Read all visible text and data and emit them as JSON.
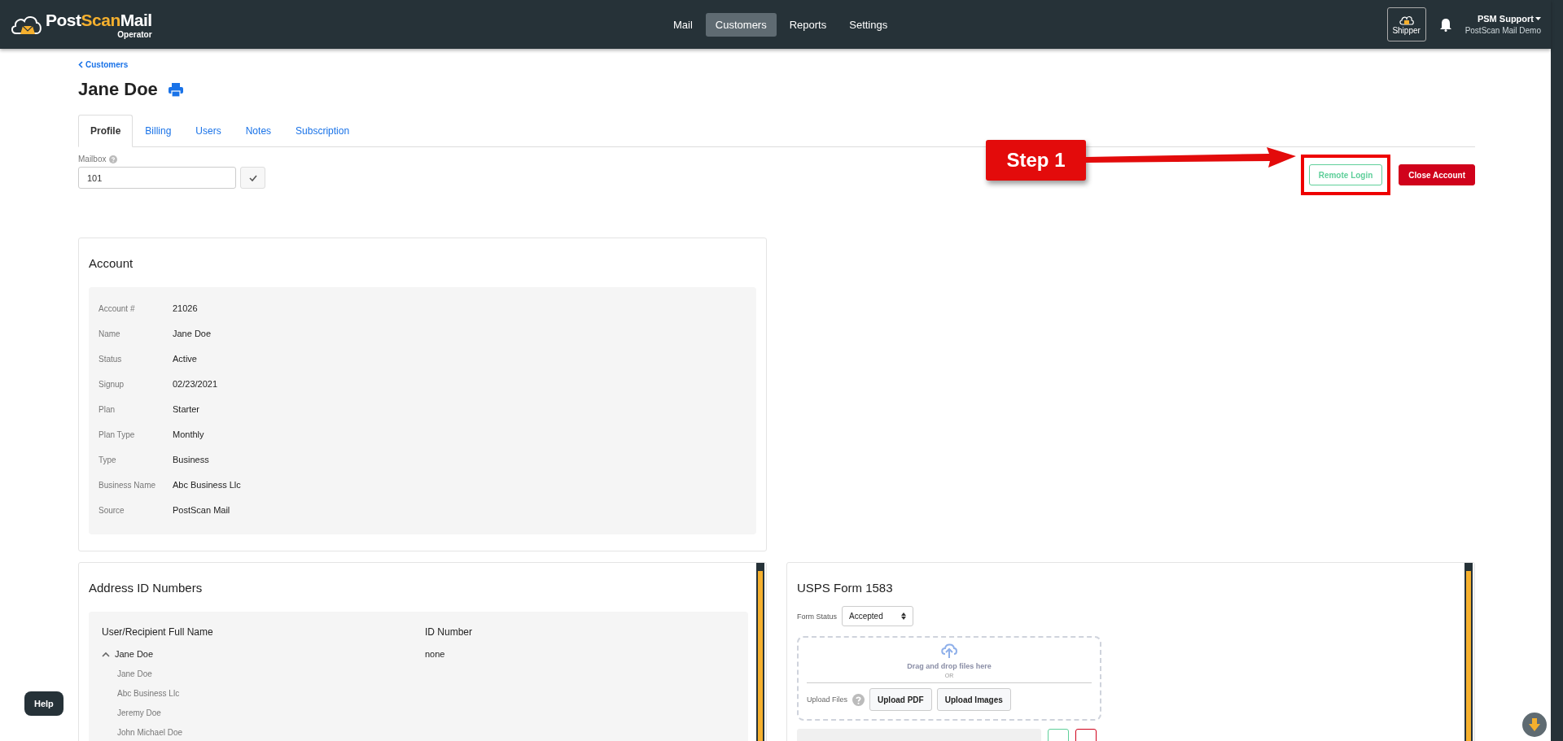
{
  "header": {
    "logo": {
      "part_1": "Post",
      "part_2": "Scan",
      "part_3": "Mail",
      "subtitle": "Operator"
    },
    "nav": [
      {
        "label": "Mail",
        "selected": false
      },
      {
        "label": "Customers",
        "selected": true
      },
      {
        "label": "Reports",
        "selected": false
      },
      {
        "label": "Settings",
        "selected": false
      }
    ],
    "shipper": "Shipper",
    "user": {
      "name": "PSM Support",
      "org": "PostScan Mail Demo"
    }
  },
  "breadcrumb": "Customers",
  "title": "Jane Doe",
  "tabs": [
    {
      "label": "Profile",
      "selected": true
    },
    {
      "label": "Billing",
      "selected": false
    },
    {
      "label": "Users",
      "selected": false
    },
    {
      "label": "Notes",
      "selected": false
    },
    {
      "label": "Subscription",
      "selected": false
    }
  ],
  "mailbox": {
    "label": "Mailbox",
    "value": "101"
  },
  "actions": [
    {
      "label": "Remote Login",
      "kind": "outline"
    },
    {
      "label": "Close Account",
      "kind": "danger"
    }
  ],
  "annotation": {
    "label": "Step 1"
  },
  "account": {
    "title": "Account",
    "fields": [
      {
        "label": "Account #",
        "value": "21026"
      },
      {
        "label": "Name",
        "value": "Jane Doe"
      },
      {
        "label": "Status",
        "value": "Active"
      },
      {
        "label": "Signup",
        "value": "02/23/2021"
      },
      {
        "label": "Plan",
        "value": "Starter"
      },
      {
        "label": "Plan Type",
        "value": "Monthly"
      },
      {
        "label": "Type",
        "value": "Business"
      },
      {
        "label": "Business Name",
        "value": "Abc Business Llc"
      },
      {
        "label": "Source",
        "value": "PostScan Mail"
      }
    ]
  },
  "address_ids": {
    "title": "Address ID Numbers",
    "columns": [
      "User/Recipient Full Name",
      "ID Number"
    ],
    "rows": [
      {
        "name": "Jane Doe",
        "id": "none",
        "expanded": true,
        "children": [
          {
            "name": "Jane Doe"
          },
          {
            "name": "Abc Business Llc"
          },
          {
            "name": "Jeremy Doe"
          },
          {
            "name": "John Michael Doe"
          }
        ]
      }
    ]
  },
  "usps_form": {
    "title": "USPS Form 1583",
    "status_label": "Form Status",
    "status_value": "Accepted",
    "drop_text": "Drag and drop files here",
    "or_text": "OR",
    "upload_label": "Upload Files",
    "buttons": [
      "Upload PDF",
      "Upload Images"
    ]
  },
  "help": "Help"
}
